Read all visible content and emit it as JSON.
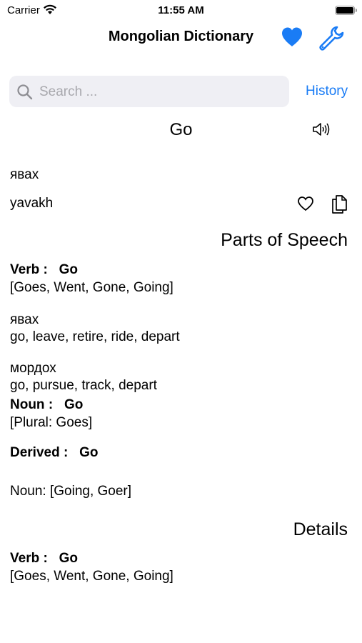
{
  "status_bar": {
    "carrier": "Carrier",
    "time": "11:55 AM"
  },
  "nav": {
    "title": "Mongolian Dictionary"
  },
  "search": {
    "placeholder": "Search ...",
    "history_label": "History"
  },
  "entry": {
    "word": "Go",
    "mongolian": "явах",
    "transliteration": "yavakh"
  },
  "parts_of_speech": {
    "heading": "Parts of Speech",
    "verb_label": "Verb :",
    "verb_word": "Go",
    "verb_forms": "[Goes, Went, Gone, Going]",
    "translations": [
      {
        "mongolian": "явах",
        "meanings": "go, leave, retire, ride, depart"
      },
      {
        "mongolian": "мордох",
        "meanings": "go, pursue, track, depart"
      }
    ],
    "noun_label": "Noun :",
    "noun_word": "Go",
    "noun_forms": "[Plural: Goes]",
    "derived_label": "Derived :",
    "derived_word": "Go",
    "derived_noun": "Noun:  [Going, Goer]"
  },
  "details": {
    "heading": "Details",
    "verb_label": "Verb :",
    "verb_word": "Go",
    "verb_forms": "[Goes, Went, Gone, Going]"
  },
  "colors": {
    "accent": "#1a7cf5",
    "search_bg": "#efeff4"
  },
  "icons": [
    "wifi-icon",
    "battery-icon",
    "heart-icon",
    "wrench-icon",
    "search-icon",
    "speaker-icon",
    "heart-outline-icon",
    "copy-icon"
  ]
}
